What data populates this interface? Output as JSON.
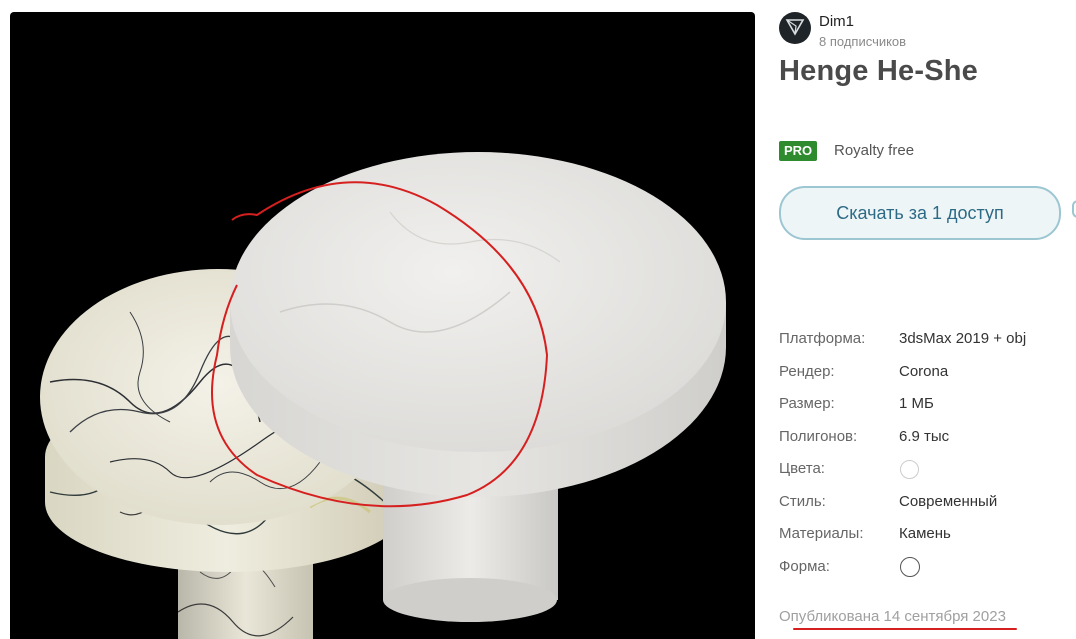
{
  "author": {
    "name": "Dim1",
    "subscribers": "8 подписчиков"
  },
  "model": {
    "title": "Henge He-She"
  },
  "license": {
    "badge": "PRO",
    "label": "Royalty free"
  },
  "download": {
    "label": "Скачать за 1 доступ"
  },
  "specs": [
    {
      "label": "Платформа:",
      "value": "3dsMax 2019 + obj"
    },
    {
      "label": "Рендер:",
      "value": "Corona"
    },
    {
      "label": "Размер:",
      "value": "1 МБ"
    },
    {
      "label": "Полигонов:",
      "value": "6.9 тыс"
    },
    {
      "label": "Цвета:",
      "value": ""
    },
    {
      "label": "Стиль:",
      "value": "Современный"
    },
    {
      "label": "Материалы:",
      "value": "Камень"
    },
    {
      "label": "Форма:",
      "value": ""
    }
  ],
  "published": "Опубликована 14 сентября 2023",
  "colors": {
    "pro_badge": "#2e8b2e",
    "button_border": "#9cc6d2",
    "button_text": "#2d6a86",
    "annotation_red": "#d62020"
  }
}
